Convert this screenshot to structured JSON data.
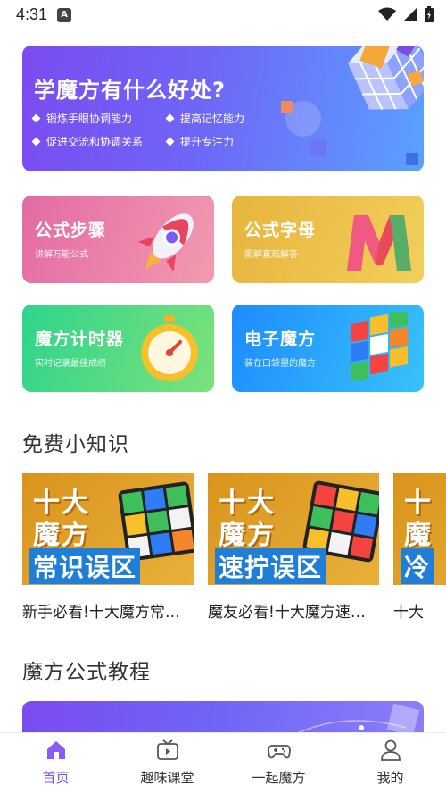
{
  "status_bar": {
    "time": "4:31"
  },
  "hero": {
    "title": "学魔方有什么好处?",
    "bullets": [
      "锻炼手眼协调能力",
      "提高记忆能力",
      "促进交流和协调关系",
      "提升专注力"
    ]
  },
  "features": [
    {
      "title": "公式步骤",
      "subtitle": "讲解万能公式",
      "icon": "rocket-icon"
    },
    {
      "title": "公式字母",
      "subtitle": "图解直观解答",
      "icon": "letter-m-icon"
    },
    {
      "title": "魔方计时器",
      "subtitle": "实时记录最佳成绩",
      "icon": "stopwatch-icon"
    },
    {
      "title": "电子魔方",
      "subtitle": "装在口袋里的魔方",
      "icon": "cube-icon"
    }
  ],
  "free_tips": {
    "heading": "免费小知识",
    "videos": [
      {
        "thumb_line1": "十大",
        "thumb_line2": "魔方",
        "thumb_tag": "常识误区",
        "title": "新手必看!十大魔方常识误区"
      },
      {
        "thumb_line1": "十大",
        "thumb_line2": "魔方",
        "thumb_tag": "速拧误区",
        "title": "魔友必看!十大魔方速拧误区"
      },
      {
        "thumb_line1": "十",
        "thumb_line2": "魔",
        "thumb_tag": "冷",
        "title": "十大"
      }
    ]
  },
  "tutorials": {
    "heading": "魔方公式教程"
  },
  "tabbar": {
    "accent": "#7b4ff0",
    "tabs": [
      {
        "label": "首页",
        "icon": "home-icon",
        "active": true
      },
      {
        "label": "趣味课堂",
        "icon": "tv-icon",
        "active": false
      },
      {
        "label": "一起魔方",
        "icon": "gamepad-icon",
        "active": false
      },
      {
        "label": "我的",
        "icon": "person-icon",
        "active": false
      }
    ]
  }
}
